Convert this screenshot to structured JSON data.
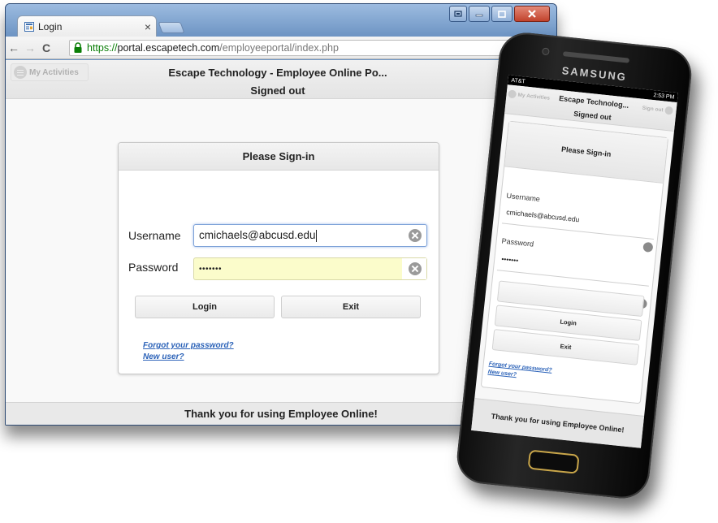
{
  "browser": {
    "tab_title": "Login",
    "tab_close": "×",
    "url": {
      "scheme": "https://",
      "host": "portal.escapetech.com",
      "path": "/employeeportal/index.php"
    },
    "nav": {
      "back": "←",
      "forward": "→",
      "reload": "C"
    }
  },
  "page": {
    "my_activities": "My Activities",
    "title": "Escape Technology - Employee Online Po...",
    "status": "Signed out",
    "footer": "Thank you for using Employee Online!",
    "card": {
      "header": "Please Sign-in",
      "username_label": "Username",
      "username_value": "cmichaels@abcusd.edu",
      "password_label": "Password",
      "password_value": "•••••••",
      "login_label": "Login",
      "exit_label": "Exit",
      "forgot_link": "Forgot your password?",
      "new_user_link": "New user?"
    }
  },
  "phone": {
    "brand": "SAMSUNG",
    "carrier": "AT&T",
    "time": "2:53 PM",
    "my_activities": "My Activities",
    "title": "Escape Technolog...",
    "status": "Signed out",
    "sign_out": "Sign out",
    "card_header": "Please Sign-in",
    "username_label": "Username",
    "username_value": "cmichaels@abcusd.edu",
    "password_label": "Password",
    "password_value": "•••••••",
    "login_label": "Login",
    "exit_label": "Exit",
    "forgot_link": "Forgot your password?",
    "new_user_link": "New user?",
    "footer": "Thank you for using Employee Online!"
  },
  "colors": {
    "link": "#2b62b8",
    "secure_url": "#0a7e07",
    "password_autofill": "#fbfccb",
    "window_frame": "#6f97c6",
    "close_button": "#c1422c"
  },
  "icons": [
    "page-favicon-icon",
    "lock-icon",
    "clear-icon",
    "menu-icon",
    "window-close-icon",
    "window-minimize-icon",
    "window-maximize-icon"
  ]
}
